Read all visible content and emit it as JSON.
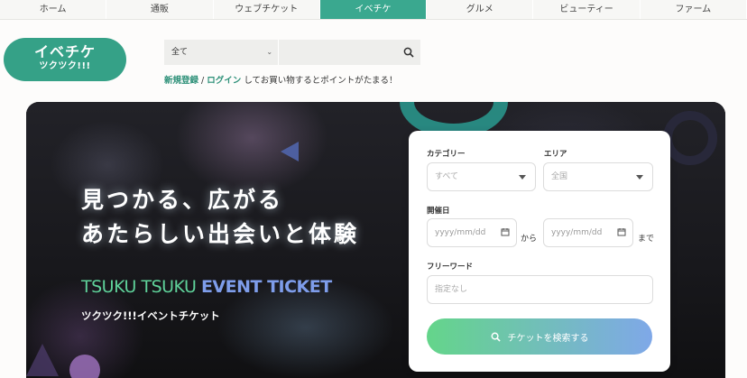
{
  "nav": {
    "items": [
      {
        "label": "ホーム"
      },
      {
        "label": "通販"
      },
      {
        "label": "ウェブチケット"
      },
      {
        "label": "イベチケ"
      },
      {
        "label": "グルメ"
      },
      {
        "label": "ビューティー"
      },
      {
        "label": "ファーム"
      }
    ],
    "active_index": 3
  },
  "logo": {
    "line1": "イベチケ",
    "line2": "ツクツク!!!"
  },
  "search": {
    "category_selected": "全て",
    "placeholder": "",
    "icon": "search-icon"
  },
  "account": {
    "register": "新規登録",
    "separator": "/",
    "login": "ログイン",
    "suffix": "してお買い物するとポイントがたまる！"
  },
  "hero": {
    "headline_line1": "見つかる、広がる",
    "headline_line2": "あたらしい出会いと体験",
    "brand_en_part1": "TSUKU TSUKU ",
    "brand_en_part2": "EVENT TICKET",
    "brand_jp": "ツクツク!!!イベントチケット"
  },
  "panel": {
    "category_label": "カテゴリー",
    "category_value": "すべて",
    "area_label": "エリア",
    "area_value": "全国",
    "date_label": "開催日",
    "date_from_placeholder": "yyyy/mm/dd",
    "from_text": "から",
    "date_to_placeholder": "yyyy/mm/dd",
    "to_text": "まで",
    "keyword_label": "フリーワード",
    "keyword_placeholder": "指定なし",
    "submit_label": "チケットを検索する"
  },
  "colors": {
    "accent": "#3aa88f",
    "brand_green": "#35a187",
    "gradient_start": "#64d58a",
    "gradient_end": "#7fa8e8"
  }
}
